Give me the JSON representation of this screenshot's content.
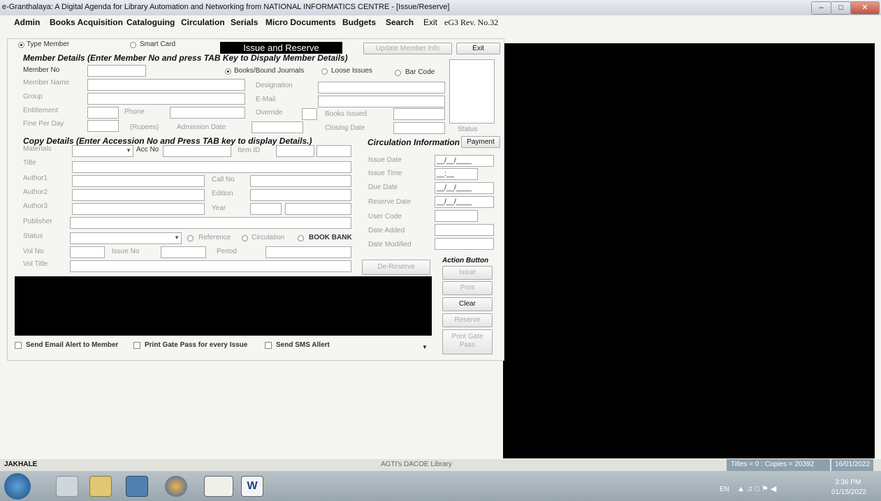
{
  "window": {
    "title": "e-Granthalaya: A Digital Agenda for Library Automation and Networking from NATIONAL INFORMATICS CENTRE - [Issue/Reserve]",
    "min_icon": "minimize-icon",
    "restore_icon": "restore-icon",
    "close_icon": "close-icon"
  },
  "menu": {
    "items": [
      "Admin",
      "Books Acquisition",
      "Cataloguing",
      "Circulation",
      "Serials",
      "Micro Documents",
      "Budgets",
      "Search",
      "Exit"
    ],
    "version": "eG3 Rev. No.32"
  },
  "form": {
    "type_member": "Type Member",
    "smart_card": "Smart Card",
    "title": "Issue and Reserve",
    "update_member_info": "Update Member Info",
    "exit": "Exit",
    "member_section": "Member Details (Enter Member No and press TAB Key to Dispaly Member Details)",
    "member_no": "Member No",
    "books_bound": "Books/Bound Journals",
    "loose_issues": "Loose Issues",
    "bar_code": "Bar Code",
    "member_name": "Member Name",
    "designation": "Designation",
    "group": "Group",
    "email": "E-Mail",
    "entitlement": "Entitlement",
    "phone": "Phone",
    "override": "Override",
    "books_issued": "Books Issued",
    "fine_per_day": "Fine Per Day",
    "rupees": "(Rupees)",
    "admission_date": "Admission Date",
    "closing_date": "Closing Date",
    "status_right": "Status",
    "copy_section": "Copy Details (Enter Accession No and Press TAB key to display Details.)",
    "materials": "Materials",
    "acc_no": "Acc No",
    "item_id": "Item ID",
    "title_label": "Title",
    "author1": "Author1",
    "author2": "Author2",
    "author3": "Author3",
    "call_no": "Call No",
    "edition": "Edition",
    "year": "Year",
    "publisher": "Publisher",
    "status": "Status",
    "reference": "Reference",
    "circulation": "Circulation",
    "book_bank": "BOOK BANK",
    "vol_no": "Vol No",
    "issue_no": "Issue No",
    "period": "Period",
    "vol_title": "Vol Title",
    "circ_section": "Circulation Information",
    "payment": "Payment",
    "issue_date": "Issue Date",
    "issue_time": "Issue Time",
    "due_date": "Due Date",
    "reserve_date": "Reserve Date",
    "user_code": "User Code",
    "date_added": "Date Added",
    "date_modified": "Date Modified",
    "date_mask": "__/__/____",
    "time_mask": "__:__",
    "de_reserve": "De-Reserve",
    "action_button": "Action Button",
    "btn_issue": "Issue",
    "btn_print": "Print",
    "btn_clear": "Clear",
    "btn_reserve": "Reserve",
    "btn_print_gate_pass": "Print Gate Pass",
    "send_email": "Send Email Alert to Member",
    "print_gate_pass_every": "Print Gate Pass for every Issue",
    "send_sms": "Send SMS Allert"
  },
  "statusbar": {
    "user": "JAKHALE",
    "library": "AGTI's DACOE Library",
    "titles": "Titles = 0 : Copies = 20392",
    "date": "16/01/2022"
  },
  "taskbar": {
    "lang": "EN",
    "time": "3:36 PM",
    "date": "01/15/2022"
  }
}
